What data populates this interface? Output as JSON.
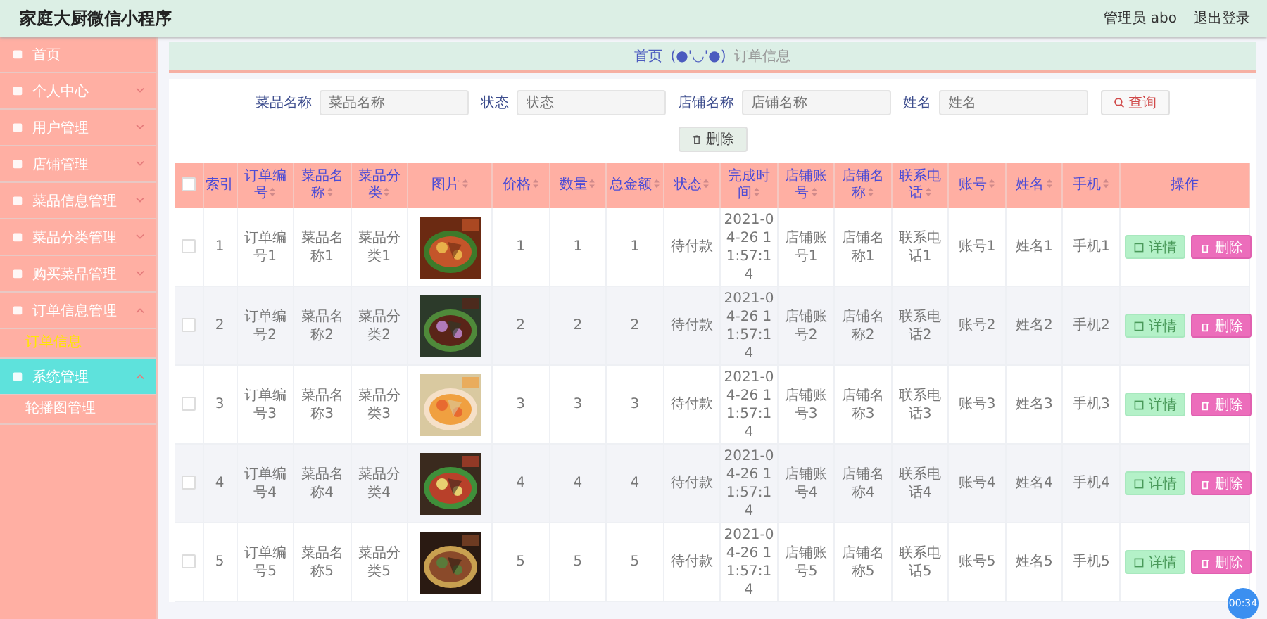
{
  "header": {
    "title": "家庭大厨微信小程序",
    "user": "管理员 abo",
    "logout": "退出登录"
  },
  "sidebar": {
    "items": [
      {
        "label": "首页",
        "has_menu": false,
        "selected": false
      },
      {
        "label": "个人中心",
        "has_menu": true,
        "expanded": false,
        "selected": false
      },
      {
        "label": "用户管理",
        "has_menu": true,
        "expanded": false,
        "selected": false
      },
      {
        "label": "店铺管理",
        "has_menu": true,
        "expanded": false,
        "selected": false
      },
      {
        "label": "菜品信息管理",
        "has_menu": true,
        "expanded": false,
        "selected": false
      },
      {
        "label": "菜品分类管理",
        "has_menu": true,
        "expanded": false,
        "selected": false
      },
      {
        "label": "购买菜品管理",
        "has_menu": true,
        "expanded": false,
        "selected": false
      },
      {
        "label": "订单信息管理",
        "has_menu": true,
        "expanded": true,
        "selected": false,
        "children": [
          {
            "label": "订单信息",
            "selected": true
          }
        ]
      },
      {
        "label": "系统管理",
        "has_menu": true,
        "expanded": true,
        "selected": true,
        "children": [
          {
            "label": "轮播图管理",
            "selected": false
          }
        ]
      }
    ]
  },
  "breadcrumb": {
    "home": "首页",
    "separator": "(●'◡'●)",
    "current": "订单信息"
  },
  "search": {
    "fields": [
      {
        "label": "菜品名称",
        "placeholder": "菜品名称"
      },
      {
        "label": "状态",
        "placeholder": "状态"
      },
      {
        "label": "店铺名称",
        "placeholder": "店铺名称"
      },
      {
        "label": "姓名",
        "placeholder": "姓名"
      }
    ],
    "query_button": "查询",
    "delete_button": "删除"
  },
  "table": {
    "columns": [
      {
        "label": "索引",
        "sortable": false
      },
      {
        "label": "订单编号",
        "sortable": true
      },
      {
        "label": "菜品名称",
        "sortable": true
      },
      {
        "label": "菜品分类",
        "sortable": true
      },
      {
        "label": "图片",
        "sortable": true
      },
      {
        "label": "价格",
        "sortable": true
      },
      {
        "label": "数量",
        "sortable": true
      },
      {
        "label": "总金额",
        "sortable": true
      },
      {
        "label": "状态",
        "sortable": true
      },
      {
        "label": "完成时间",
        "sortable": true
      },
      {
        "label": "店铺账号",
        "sortable": true
      },
      {
        "label": "店铺名称",
        "sortable": true
      },
      {
        "label": "联系电话",
        "sortable": true
      },
      {
        "label": "账号",
        "sortable": true
      },
      {
        "label": "姓名",
        "sortable": true
      },
      {
        "label": "手机",
        "sortable": true
      },
      {
        "label": "操作",
        "sortable": false
      }
    ],
    "all_checked": false,
    "rows": [
      {
        "checked": false,
        "cells": [
          "1",
          "订单编号1",
          "菜品名称1",
          "菜品分类1",
          null,
          "1",
          "1",
          "1",
          "待付款",
          "2021-04-26 11:57:14",
          "店铺账号1",
          "店铺名称1",
          "联系电话1",
          "账号1",
          "姓名1",
          "手机1"
        ],
        "picture": {
          "kind": "picture"
        },
        "detail": "详情",
        "delete": "删除"
      },
      {
        "checked": false,
        "cells": [
          "2",
          "订单编号2",
          "菜品名称2",
          "菜品分类2",
          null,
          "2",
          "2",
          "2",
          "待付款",
          "2021-04-26 11:57:14",
          "店铺账号2",
          "店铺名称2",
          "联系电话2",
          "账号2",
          "姓名2",
          "手机2"
        ],
        "picture": {
          "kind": "picture"
        },
        "detail": "详情",
        "delete": "删除"
      },
      {
        "checked": false,
        "cells": [
          "3",
          "订单编号3",
          "菜品名称3",
          "菜品分类3",
          null,
          "3",
          "3",
          "3",
          "待付款",
          "2021-04-26 11:57:14",
          "店铺账号3",
          "店铺名称3",
          "联系电话3",
          "账号3",
          "姓名3",
          "手机3"
        ],
        "picture": {
          "kind": "picture"
        },
        "detail": "详情",
        "delete": "删除"
      },
      {
        "checked": false,
        "cells": [
          "4",
          "订单编号4",
          "菜品名称4",
          "菜品分类4",
          null,
          "4",
          "4",
          "4",
          "待付款",
          "2021-04-26 11:57:14",
          "店铺账号4",
          "店铺名称4",
          "联系电话4",
          "账号4",
          "姓名4",
          "手机4"
        ],
        "picture": {
          "kind": "picture"
        },
        "detail": "详情",
        "delete": "删除"
      },
      {
        "checked": false,
        "cells": [
          "5",
          "订单编号5",
          "菜品名称5",
          "菜品分类5",
          null,
          "5",
          "5",
          "5",
          "待付款",
          "2021-04-26 11:57:14",
          "店铺账号5",
          "店铺名称5",
          "联系电话5",
          "账号5",
          "姓名5",
          "手机5"
        ],
        "picture": {
          "kind": "picture"
        },
        "detail": "详情",
        "delete": "删除"
      }
    ]
  },
  "timer": "00:34"
}
